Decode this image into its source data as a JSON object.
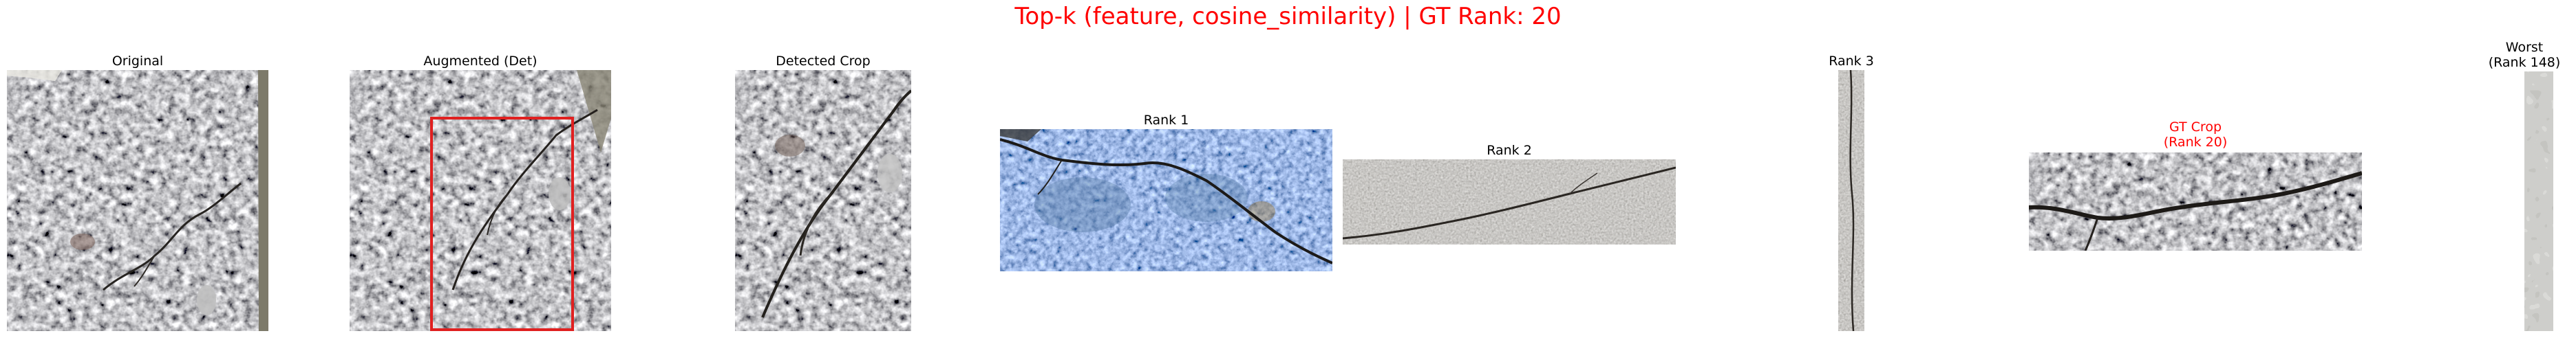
{
  "figure": {
    "title": "Top-k (feature, cosine_similarity) | GT Rank: 20"
  },
  "panels": [
    {
      "id": "original",
      "title": "Original"
    },
    {
      "id": "augmented",
      "title": "Augmented (Det)"
    },
    {
      "id": "detected",
      "title": "Detected Crop"
    },
    {
      "id": "rank1",
      "title": "Rank 1"
    },
    {
      "id": "rank2",
      "title": "Rank 2"
    },
    {
      "id": "rank3",
      "title": "Rank 3"
    },
    {
      "id": "gt",
      "title_line1": "GT Crop",
      "title_line2": "(Rank 20)"
    },
    {
      "id": "worst",
      "title_line1": "Worst",
      "title_line2": "(Rank 148)"
    }
  ],
  "colors": {
    "title": "#ff0000",
    "gt_label": "#ff0000",
    "detection_box": "#e02020"
  }
}
